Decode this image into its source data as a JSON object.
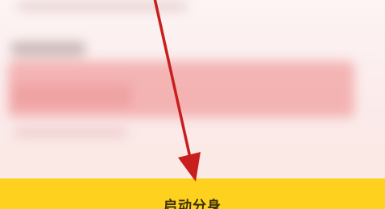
{
  "launch_button": {
    "label": "启动分身"
  },
  "annotation": {
    "icon": "arrow-down-icon",
    "color": "#c81e1e"
  },
  "colors": {
    "button_bg": "#ffd11f",
    "button_text": "#3a2f05",
    "content_blur": "#f2a9a9"
  }
}
